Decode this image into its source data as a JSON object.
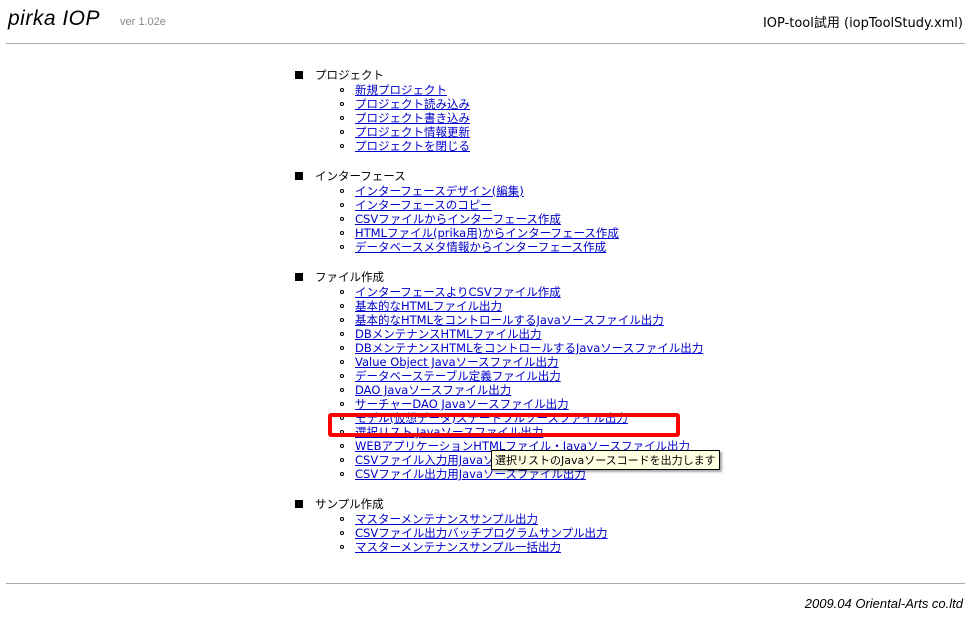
{
  "header": {
    "app_title": "pirka IOP",
    "version": "ver 1.02e",
    "project_file": "IOP-tool試用 (iopToolStudy.xml)"
  },
  "sections": [
    {
      "title": "プロジェクト",
      "items": [
        "新規プロジェクト",
        "プロジェクト読み込み",
        "プロジェクト書き込み",
        "プロジェクト情報更新",
        "プロジェクトを閉じる"
      ]
    },
    {
      "title": "インターフェース",
      "items": [
        "インターフェースデザイン(編集)",
        "インターフェースのコピー",
        "CSVファイルからインターフェース作成",
        "HTMLファイル(prika用)からインターフェース作成",
        "データベースメタ情報からインターフェース作成"
      ]
    },
    {
      "title": "ファイル作成",
      "items": [
        "インターフェースよりCSVファイル作成",
        "基本的なHTMLファイル出力",
        "基本的なHTMLをコントロールするJavaソースファイル出力",
        "DBメンテナンスHTMLファイル出力",
        "DBメンテナンスHTMLをコントロールするJavaソースファイル出力",
        "Value Object Javaソースファイル出力",
        "データベーステーブル定義ファイル出力",
        "DAO Javaソースファイル出力",
        "サーチャーDAO Javaソースファイル出力",
        "モデル(仮想データ)ステートフルソースファイル出力",
        "選択リスト Javaソースファイル出力",
        "WEBアプリケーションHTMLファイル・Javaソースファイル出力",
        "CSVファイル入力用Javaソースファイル出力",
        "CSVファイル出力用Javaソースファイル出力"
      ]
    },
    {
      "title": "サンプル作成",
      "items": [
        "マスターメンテナンスサンプル出力",
        "CSVファイル出力バッチプログラムサンプル出力",
        "マスターメンテナンスサンプル一括出力"
      ]
    }
  ],
  "tooltip": "選択リストのJavaソースコードを出力します",
  "footer": {
    "credit": "2009.04 Oriental-Arts co.ltd"
  },
  "colors": {
    "link": "#0000cc",
    "highlight": "#ff0000",
    "tooltip_bg": "#ffffe1"
  }
}
